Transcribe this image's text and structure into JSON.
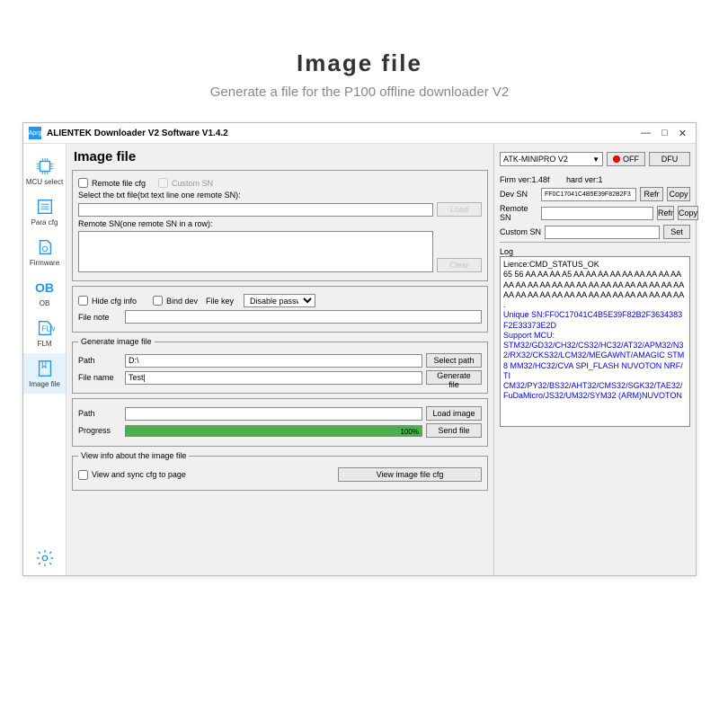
{
  "banner": {
    "title": "Image file",
    "subtitle": "Generate a file for the P100 offline downloader V2"
  },
  "titlebar": {
    "icon": "Aprg",
    "text": "ALIENTEK  Downloader V2 Software V1.4.2"
  },
  "sidebar": {
    "items": [
      {
        "label": "MCU select"
      },
      {
        "label": "Para cfg"
      },
      {
        "label": "Firmware"
      },
      {
        "label": "OB"
      },
      {
        "label": "FLM"
      },
      {
        "label": "Image file"
      }
    ]
  },
  "main": {
    "heading": "Image file",
    "remote_file_cfg": "Remote file cfg",
    "custom_sn": "Custom SN",
    "select_txt": "Select the txt file(txt text line one remote SN):",
    "load": "Load",
    "remote_sn_label": "Remote SN(one remote SN in a row):",
    "clear": "Clear",
    "hide_cfg": "Hide cfg info",
    "bind_dev": "Bind dev",
    "file_key": "File key",
    "disable_passw": "Disable passw",
    "file_note": "File note",
    "gen_legend": "Generate image file",
    "path_lbl": "Path",
    "path_val": "D:\\",
    "select_path": "Select path",
    "file_name_lbl": "File name",
    "file_name_val": "Test|",
    "generate_file": "Generate file",
    "path2": "Path",
    "load_image": "Load image",
    "progress_lbl": "Progress",
    "progress_pct": "100%",
    "send_file": "Send file",
    "view_legend": "View info about the image file",
    "view_sync": "View and sync cfg to page",
    "view_btn": "View image file cfg"
  },
  "right": {
    "device": "ATK-MINIPRO V2",
    "off": "OFF",
    "dfu": "DFU",
    "firm": "Firm ver:1.48f",
    "hard": "hard ver:1",
    "dev_sn": "Dev SN",
    "dev_sn_val": "FF0C17041C4B5E39F82B2F3",
    "remote_sn": "Remote SN",
    "custom_sn": "Custom SN",
    "refr": "Refr",
    "copy": "Copy",
    "set": "Set",
    "log_lbl": "Log",
    "log_line1": "Lience:CMD_STATUS_OK",
    "log_line2": "65 56 AA AA AA A5 AA AA AA AA AA AA AA AA AA AA AA AA AA AA AA AA AA AA AA AA AA AA AA AA AA AA AA AA AA AA AA AA AA AA AA AA AA AA AA .",
    "log_blue1": "Unique SN:FF0C17041C4B5E39F82B2F3634383F2E33373E2D",
    "log_blue2": "Support MCU:",
    "log_blue3": "STM32/GD32/CH32/CS32/HC32/AT32/APM32/N32/RX32/CKS32/LCM32/MEGAWNT/AMAGIC STM8 MM32/HC32/CVA SPI_FLASH NUVOTON NRF/TI",
    "log_blue4": "CM32/PY32/BS32/AHT32/CMS32/SGK32/TAE32/FuDaMicro/JS32/UM32/SYM32 (ARM)NUVOTON"
  }
}
